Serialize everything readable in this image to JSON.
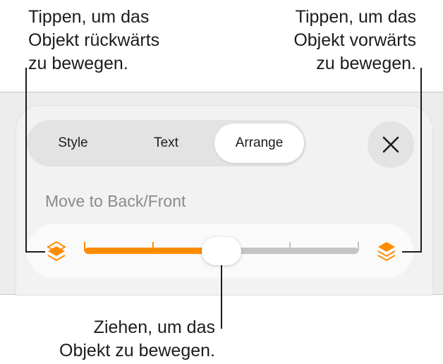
{
  "callouts": {
    "left": "Tippen, um das\nObjekt rückwärts\nzu bewegen.",
    "right": "Tippen, um das\nObjekt vorwärts\nzu bewegen.",
    "bottom": "Ziehen, um das\nObjekt zu bewegen."
  },
  "tabs": [
    {
      "label": "Style",
      "active": false
    },
    {
      "label": "Text",
      "active": false
    },
    {
      "label": "Arrange",
      "active": true
    }
  ],
  "section": {
    "label": "Move to Back/Front"
  },
  "slider": {
    "position": 0.5,
    "ticks": 5
  },
  "icons": {
    "close": "close-icon",
    "back": "move-backward-layers-icon",
    "front": "move-forward-layers-icon"
  },
  "colors": {
    "accent": "#ff8c00",
    "track": "#c4c4c4"
  }
}
